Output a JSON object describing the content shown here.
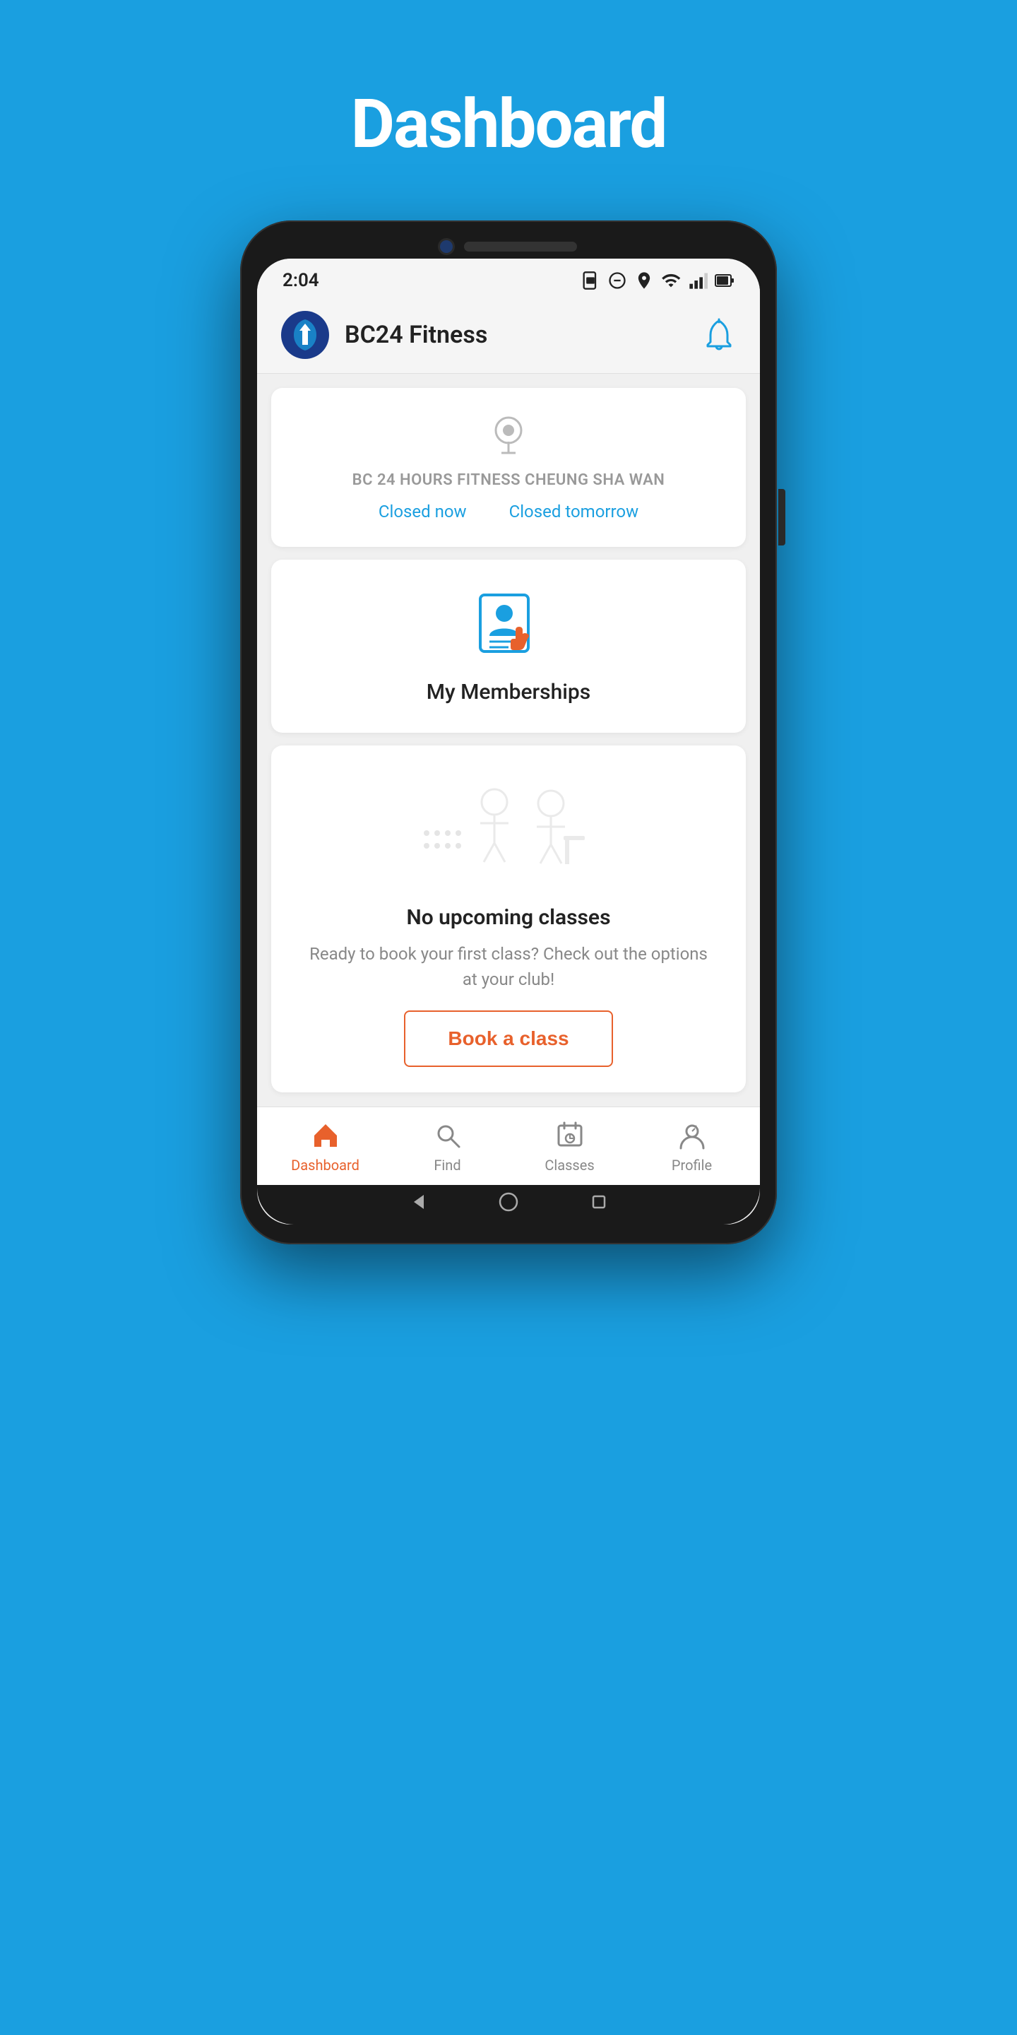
{
  "page": {
    "title": "Dashboard",
    "background_color": "#1a9fe0"
  },
  "status_bar": {
    "time": "2:04",
    "icons": [
      "sim",
      "dnd",
      "location",
      "wifi",
      "signal",
      "battery"
    ]
  },
  "header": {
    "app_name": "BC24 Fitness",
    "logo_alt": "BC24 Fitness Logo",
    "bell_label": "notifications"
  },
  "location_card": {
    "location_icon": "pin",
    "location_name": "BC 24 HOURS FITNESS  CHEUNG SHA WAN",
    "status_left": "Closed now",
    "status_right": "Closed tomorrow"
  },
  "membership_card": {
    "label": "My Memberships",
    "icon": "membership"
  },
  "classes_card": {
    "title": "No upcoming classes",
    "description": "Ready to book your first class? Check out the options at your club!",
    "book_button": "Book a class"
  },
  "bottom_nav": {
    "items": [
      {
        "id": "dashboard",
        "label": "Dashboard",
        "active": true
      },
      {
        "id": "find",
        "label": "Find",
        "active": false
      },
      {
        "id": "classes",
        "label": "Classes",
        "active": false
      },
      {
        "id": "profile",
        "label": "Profile",
        "active": false
      }
    ]
  },
  "nav_buttons": {
    "back": "◀",
    "home": "●",
    "recent": "■"
  }
}
